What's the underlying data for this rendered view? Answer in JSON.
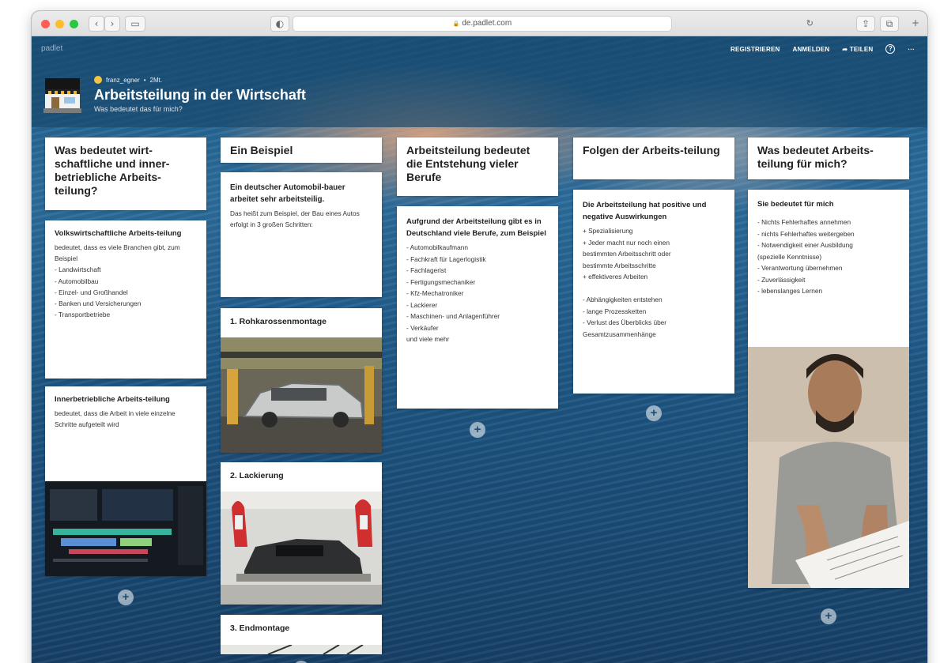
{
  "browser": {
    "url": "de.padlet.com",
    "lock_icon": "🔒"
  },
  "header": {
    "watermark": "padlet",
    "links": [
      "REGISTRIEREN",
      "ANMELDEN",
      "TEILEN"
    ],
    "author": "franz_egner",
    "time": "2Mt.",
    "title": "Arbeitsteilung in der Wirtschaft",
    "subtitle": "Was bedeutet das für mich?"
  },
  "columns": [
    {
      "title": "Was bedeutet wirt-schaftliche und inner-betriebliche Arbeits-teilung?",
      "cards": [
        {
          "title": "Volkswirtschaftliche Arbeits-teilung",
          "body": "bedeutet, dass es viele Branchen gibt, zum Beispiel\n- Landwirtschaft\n- Automobilbau\n- Einzel- und Großhandel\n- Banken und Versicherungen\n- Transportbetriebe"
        },
        {
          "title": "Innerbetriebliche Arbeits-teilung",
          "body": "bedeutet, dass die Arbeit in viele einzelne Schritte aufgeteilt wird"
        }
      ]
    },
    {
      "title": "Ein Beispiel",
      "cards": [
        {
          "title": "Ein deutscher Automobil-bauer arbeitet sehr arbeitsteilig.",
          "body": "Das heißt zum Beispiel, der Bau eines Autos erfolgt in 3 großen Schritten:"
        },
        {
          "title": "1. Rohkarossenmontage"
        },
        {
          "title": "2. Lackierung"
        },
        {
          "title": "3. Endmontage"
        }
      ]
    },
    {
      "title": "Arbeitsteilung bedeutet die Entstehung vieler Berufe",
      "cards": [
        {
          "title": "Aufgrund der Arbeitsteilung gibt es in Deutschland viele Berufe, zum Beispiel",
          "body": "- Automobilkaufmann\n- Fachkraft für Lagerlogistik\n- Fachlagerist\n- Fertigungsmechaniker\n- Kfz-Mechatroniker\n- Lackierer\n- Maschinen- und Anlagenführer\n- Verkäufer\n  und viele mehr"
        }
      ]
    },
    {
      "title": "Folgen der Arbeits-teilung",
      "cards": [
        {
          "title": "Die Arbeitsteilung hat positive und negative Auswirkungen",
          "body": "+ Spezialisierung\n+ Jeder macht nur noch einen\n   bestimmten Arbeitsschritt oder\n   bestimmte Arbeitsschritte\n+ effektiveres Arbeiten\n\n-  Abhängigkeiten entstehen\n-  lange Prozessketten\n-  Verlust des Überblicks über\n   Gesamtzusammenhänge"
        }
      ]
    },
    {
      "title": "Was bedeutet Arbeits-teilung für mich?",
      "cards": [
        {
          "title": "Sie bedeutet für mich",
          "body": "- Nichts Fehlerhaftes annehmen\n- nichts Fehlerhaftes weitergeben\n- Notwendigkeit einer Ausbildung\n  (spezielle Kenntnisse)\n- Verantwortung übernehmen\n- Zuverlässigkeit\n- lebenslanges Lernen"
        }
      ]
    }
  ],
  "add_glyph": "+"
}
